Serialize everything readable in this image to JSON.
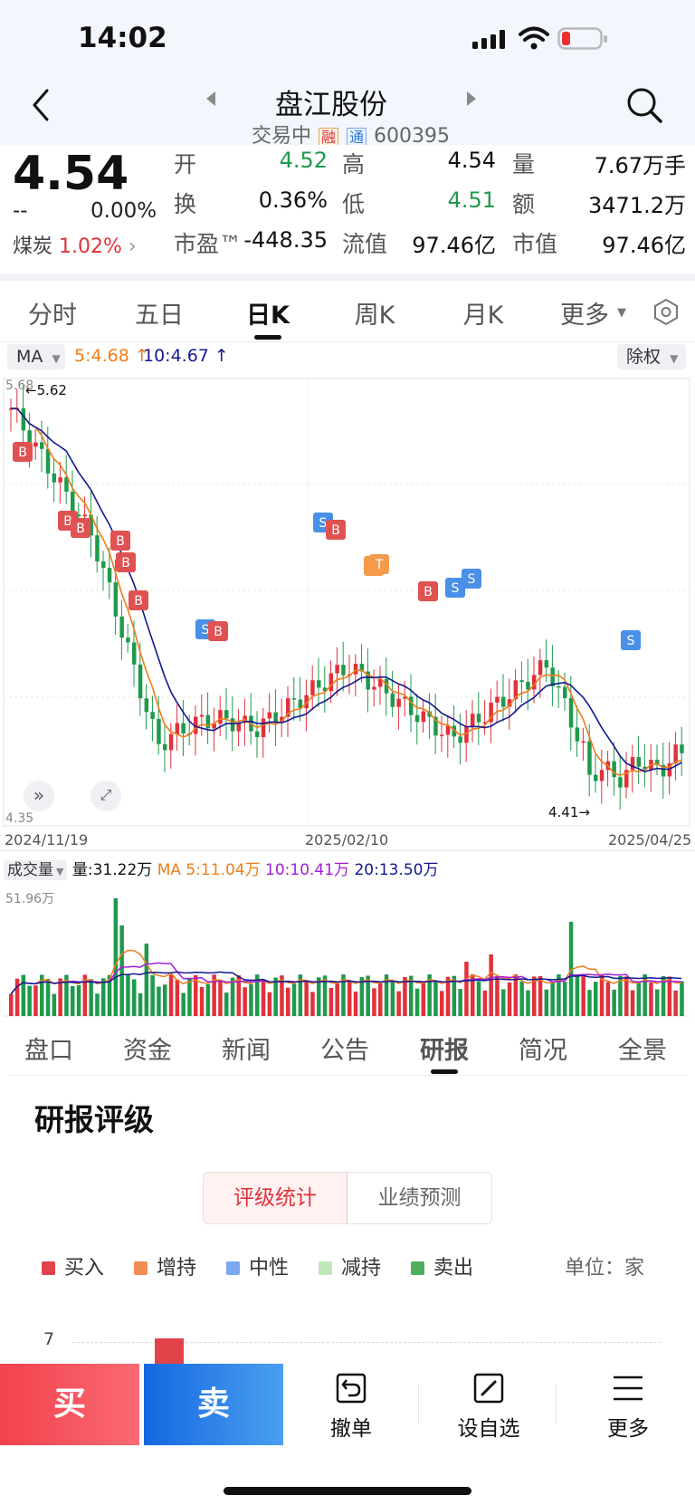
{
  "status_bar": {
    "time": "14:02"
  },
  "header": {
    "stock_name": "盘江股份",
    "status": "交易中",
    "tag_rong": "融",
    "tag_tong": "通",
    "code": "600395"
  },
  "quote": {
    "price": "4.54",
    "change": "--",
    "change_pct": "0.00%",
    "sector_name": "煤炭",
    "sector_pct": "1.02%",
    "stats": [
      {
        "label": "开",
        "value": "4.52",
        "color": "green"
      },
      {
        "label": "高",
        "value": "4.54",
        "color": "dark"
      },
      {
        "label": "量",
        "value": "7.67万手",
        "color": "dark"
      },
      {
        "label": "换",
        "value": "0.36%",
        "color": "dark"
      },
      {
        "label": "低",
        "value": "4.51",
        "color": "green"
      },
      {
        "label": "额",
        "value": "3471.2万",
        "color": "dark"
      },
      {
        "label": "市盈™",
        "value": "-448.35",
        "color": "dark"
      },
      {
        "label": "流值",
        "value": "97.46亿",
        "color": "dark"
      },
      {
        "label": "市值",
        "value": "97.46亿",
        "color": "dark"
      }
    ]
  },
  "chart_tabs": [
    "分时",
    "五日",
    "日K",
    "周K",
    "月K",
    "更多"
  ],
  "active_chart_tab": "日K",
  "ma_bar": {
    "selector": "MA",
    "ma5": "5:4.68",
    "ma10": "10:4.67",
    "adjust": "除权"
  },
  "kline": {
    "y_top": "5.68",
    "y_bottom": "4.35",
    "high_mark": "5.62",
    "low_mark": "4.41",
    "dates": [
      "2024/11/19",
      "2025/02/10",
      "2025/04/25"
    ]
  },
  "volume": {
    "selector": "成交量",
    "vol": "量:31.22万",
    "ma5": "MA 5:11.04万",
    "ma10": "10:10.41万",
    "ma20": "20:13.50万",
    "y_top": "51.96万"
  },
  "function_tabs": [
    "盘口",
    "资金",
    "新闻",
    "公告",
    "研报",
    "简况",
    "全景"
  ],
  "active_function_tab": "研报",
  "research": {
    "title": "研报评级",
    "toggle": [
      "评级统计",
      "业绩预测"
    ],
    "legend": [
      {
        "name": "买入",
        "color": "#e2434b"
      },
      {
        "name": "增持",
        "color": "#f58b55"
      },
      {
        "name": "中性",
        "color": "#7aa8f1"
      },
      {
        "name": "减持",
        "color": "#bfe8b8"
      },
      {
        "name": "卖出",
        "color": "#4fae5d"
      }
    ],
    "unit": "单位：家",
    "y_max": "7"
  },
  "bottom_nav": {
    "buy": "买",
    "sell": "卖",
    "cancel": "撤单",
    "watch": "设自选",
    "more": "更多"
  },
  "colors": {
    "up": "#e0323a",
    "down": "#1f9a4c",
    "ma5": "#ef7d1a",
    "ma10": "#13198f",
    "ma20": "#a21ddb",
    "buy_btn": "#f2424d",
    "sell_btn": "#1877e6",
    "badge_b": "#e05252",
    "badge_s": "#4a8fe8",
    "badge_t": "#f59a4b"
  }
}
